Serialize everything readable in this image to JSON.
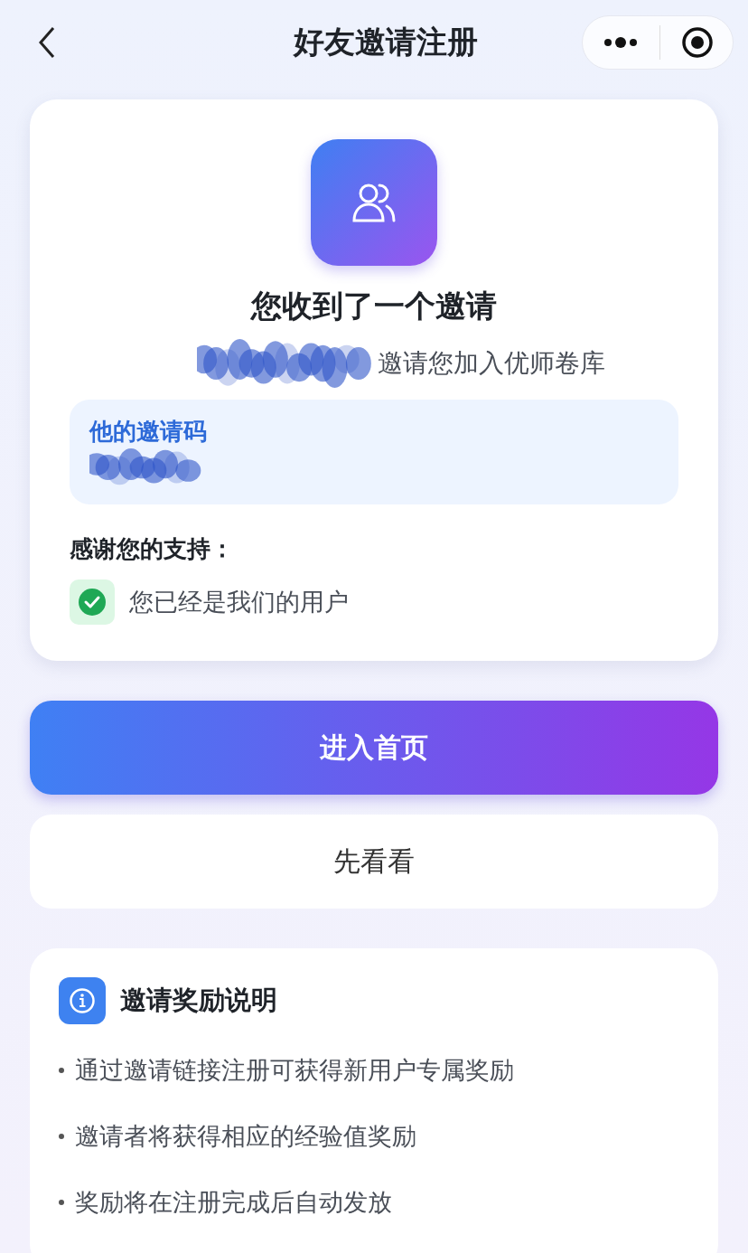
{
  "nav": {
    "title": "好友邀请注册"
  },
  "invite": {
    "heading": "您收到了一个邀请",
    "inviter_redacted": true,
    "message": "邀请您加入优师卷库",
    "code_box": {
      "label": "他的邀请码",
      "value_redacted": true
    },
    "thanks": "感谢您的支持：",
    "status": {
      "checked": true,
      "text": "您已经是我们的用户"
    }
  },
  "buttons": [
    {
      "kind": "primary",
      "label": "进入首页"
    },
    {
      "kind": "secondary",
      "label": "先看看"
    }
  ],
  "rewards": {
    "title": "邀请奖励说明",
    "items": [
      "通过邀请链接注册可获得新用户专属奖励",
      "邀请者将获得相应的经验值奖励",
      "奖励将在注册完成后自动发放"
    ]
  }
}
